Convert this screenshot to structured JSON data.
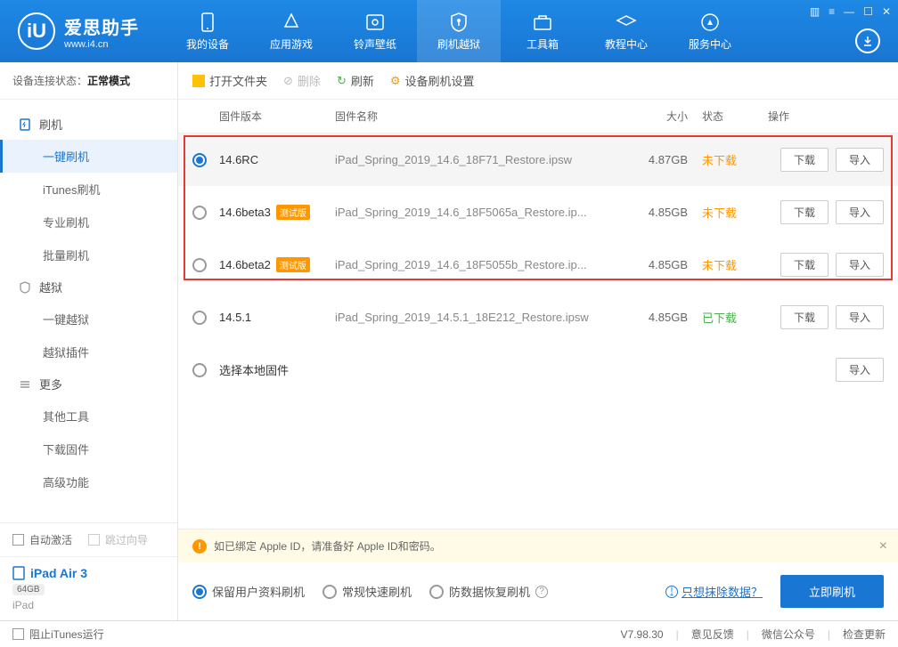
{
  "logo": {
    "title": "爱思助手",
    "sub": "www.i4.cn"
  },
  "nav": [
    {
      "label": "我的设备"
    },
    {
      "label": "应用游戏"
    },
    {
      "label": "铃声壁纸"
    },
    {
      "label": "刷机越狱"
    },
    {
      "label": "工具箱"
    },
    {
      "label": "教程中心"
    },
    {
      "label": "服务中心"
    }
  ],
  "conn": {
    "label": "设备连接状态：",
    "value": "正常模式"
  },
  "sidebar": {
    "g1": {
      "head": "刷机",
      "items": [
        "一键刷机",
        "iTunes刷机",
        "专业刷机",
        "批量刷机"
      ]
    },
    "g2": {
      "head": "越狱",
      "items": [
        "一键越狱",
        "越狱插件"
      ]
    },
    "g3": {
      "head": "更多",
      "items": [
        "其他工具",
        "下载固件",
        "高级功能"
      ]
    },
    "auto": "自动激活",
    "skip": "跳过向导",
    "device": {
      "name": "iPad Air 3",
      "storage": "64GB",
      "type": "iPad"
    }
  },
  "toolbar": {
    "open": "打开文件夹",
    "delete": "删除",
    "refresh": "刷新",
    "settings": "设备刷机设置"
  },
  "thead": {
    "ver": "固件版本",
    "name": "固件名称",
    "size": "大小",
    "status": "状态",
    "ops": "操作"
  },
  "rows": [
    {
      "ver": "14.6RC",
      "beta": "",
      "name": "iPad_Spring_2019_14.6_18F71_Restore.ipsw",
      "size": "4.87GB",
      "status": "未下载",
      "st": "und",
      "sel": true,
      "dl": true
    },
    {
      "ver": "14.6beta3",
      "beta": "测试版",
      "name": "iPad_Spring_2019_14.6_18F5065a_Restore.ip...",
      "size": "4.85GB",
      "status": "未下载",
      "st": "und",
      "sel": false,
      "dl": true
    },
    {
      "ver": "14.6beta2",
      "beta": "测试版",
      "name": "iPad_Spring_2019_14.6_18F5055b_Restore.ip...",
      "size": "4.85GB",
      "status": "未下载",
      "st": "und",
      "sel": false,
      "dl": true
    },
    {
      "ver": "14.5.1",
      "beta": "",
      "name": "iPad_Spring_2019_14.5.1_18E212_Restore.ipsw",
      "size": "4.85GB",
      "status": "已下载",
      "st": "dl",
      "sel": false,
      "dl": true
    },
    {
      "ver": "选择本地固件",
      "beta": "",
      "name": "",
      "size": "",
      "status": "",
      "st": "",
      "sel": false,
      "dl": false
    }
  ],
  "ops": {
    "download": "下载",
    "import": "导入"
  },
  "warn": "如已绑定 Apple ID，请准备好 Apple ID和密码。",
  "modes": {
    "keep": "保留用户资料刷机",
    "fast": "常规快速刷机",
    "anti": "防数据恢复刷机"
  },
  "erase": "只想抹除数据？",
  "flash": "立即刷机",
  "footer": {
    "block": "阻止iTunes运行",
    "ver": "V7.98.30",
    "feedback": "意见反馈",
    "wechat": "微信公众号",
    "update": "检查更新"
  }
}
